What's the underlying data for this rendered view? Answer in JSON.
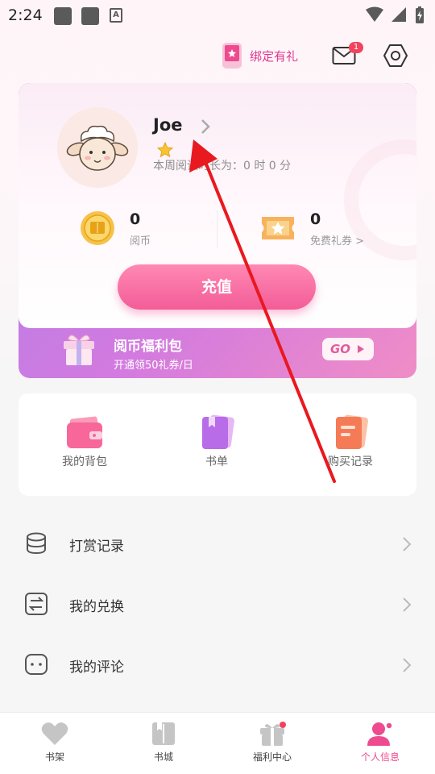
{
  "status_bar": {
    "time": "2:24",
    "a_label": "A"
  },
  "header": {
    "bind_gift_label": "绑定有礼",
    "mail_badge": "1"
  },
  "profile": {
    "username": "Joe",
    "reading_time_text": "本周阅读时长为：0 时 0 分",
    "coins": {
      "value": "0",
      "label": "阅币"
    },
    "coupons": {
      "value": "0",
      "label": "免费礼券 >"
    },
    "recharge_label": "充值",
    "welfare": {
      "title": "阅币福利包",
      "subtitle": "开通领50礼券/日",
      "go_label": "GO"
    }
  },
  "quick_actions": [
    {
      "label": "我的背包"
    },
    {
      "label": "书单"
    },
    {
      "label": "购买记录"
    }
  ],
  "menu": [
    {
      "label": "打赏记录"
    },
    {
      "label": "我的兑换"
    },
    {
      "label": "我的评论"
    }
  ],
  "tab_bar": {
    "tabs": [
      {
        "label": "书架"
      },
      {
        "label": "书城"
      },
      {
        "label": "福利中心"
      },
      {
        "label": "个人信息"
      }
    ],
    "active_index": 3
  },
  "colors": {
    "accent_pink": "#ee4a8f",
    "recharge_gradient": [
      "#ff89b3",
      "#f35c98"
    ],
    "welfare_gradient": [
      "#ac81ea",
      "#f08dc6"
    ],
    "annotation_red": "#e8191f"
  }
}
